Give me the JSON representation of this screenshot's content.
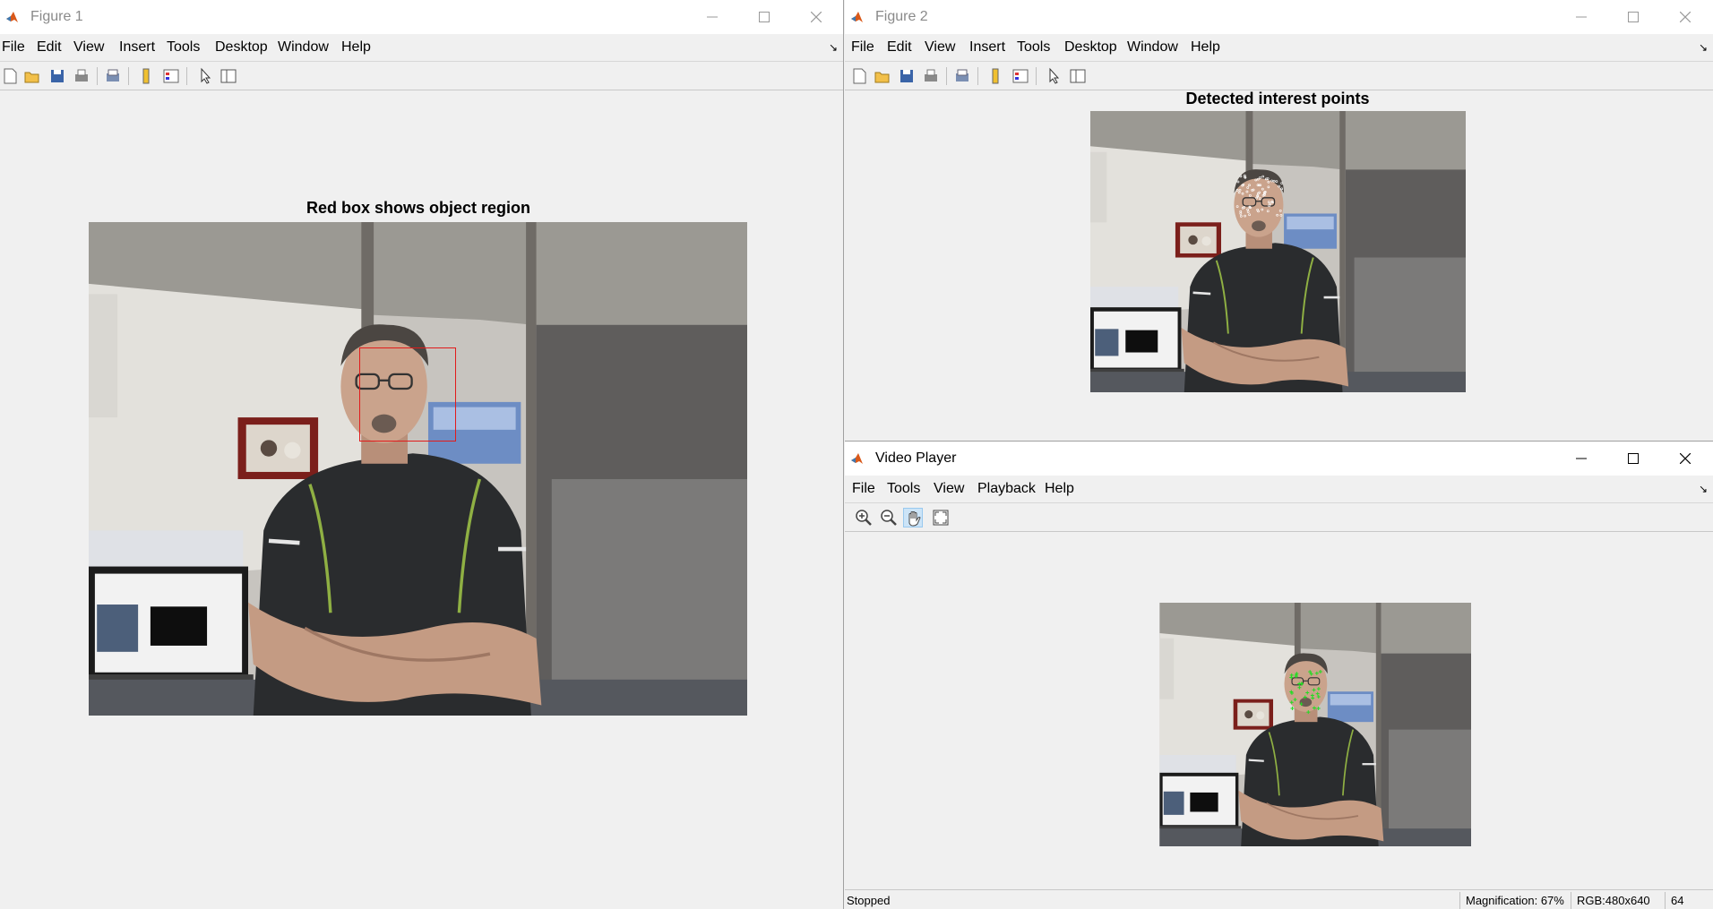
{
  "figure1": {
    "title": "Figure 1",
    "menus": [
      "File",
      "Edit",
      "View",
      "Insert",
      "Tools",
      "Desktop",
      "Window",
      "Help"
    ],
    "axes_title": "Red box shows object region"
  },
  "figure2": {
    "title": "Figure 2",
    "menus": [
      "File",
      "Edit",
      "View",
      "Insert",
      "Tools",
      "Desktop",
      "Window",
      "Help"
    ],
    "axes_title": "Detected interest points"
  },
  "video_player": {
    "title": "Video Player",
    "menus": [
      "File",
      "Tools",
      "View",
      "Playback",
      "Help"
    ],
    "status": "Stopped",
    "magnification": "Magnification: 67%",
    "image_info": "RGB:480x640",
    "frame": "64"
  },
  "icons": {
    "app": "matlab-icon",
    "figure_toolbar": [
      "new-figure-icon",
      "open-file-icon",
      "save-icon",
      "print-icon",
      "print-preview-icon",
      "colorbar-icon",
      "legend-icon",
      "edit-plot-icon",
      "property-inspector-icon"
    ],
    "video_toolbar": [
      "zoom-in-icon",
      "zoom-out-icon",
      "pan-hand-icon",
      "fit-to-window-icon"
    ]
  },
  "colors": {
    "roi_box": "#e11b1b",
    "interest_points": "#ffffff",
    "tracked_points": "#22dd22",
    "window_bg": "#f0f0f0"
  }
}
